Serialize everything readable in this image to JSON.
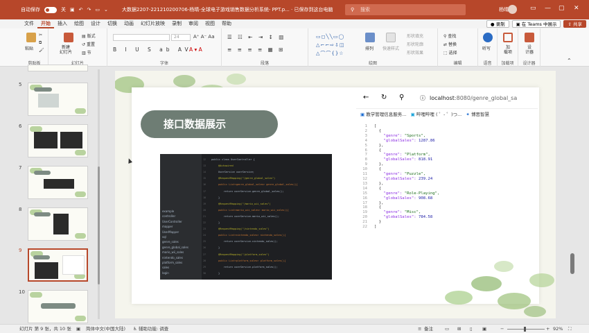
{
  "titlebar": {
    "autosave_label": "自动保存",
    "autosave_state": "关",
    "filename": "大数据2207-221210200706-杨晴-全球电子游戏销售数据分析系统- PPT.p...",
    "save_state": "已保存到这台电脑",
    "search_placeholder": "搜索",
    "user": "杨晴"
  },
  "menu": {
    "tabs": [
      "文件",
      "开始",
      "插入",
      "绘图",
      "设计",
      "切换",
      "动画",
      "幻灯片放映",
      "录制",
      "审阅",
      "视图",
      "帮助"
    ],
    "active": "开始",
    "record_btn": "录制",
    "teams_btn": "在 Teams 中展示",
    "share_btn": "共享"
  },
  "ribbon": {
    "clipboard": {
      "label": "剪贴板",
      "paste": "粘贴"
    },
    "slides": {
      "label": "幻灯片",
      "new_slide": "新建\n幻灯片",
      "layout": "版式",
      "reset": "重置",
      "section": "节"
    },
    "font": {
      "label": "字体",
      "size": "24"
    },
    "paragraph": {
      "label": "段落"
    },
    "drawing": {
      "label": "绘图",
      "arrange": "排列",
      "quick_styles": "快速样式",
      "fill": "形状填充",
      "outline": "形状轮廓",
      "effects": "形状效果"
    },
    "editing": {
      "label": "编辑",
      "find": "查找",
      "replace": "替换",
      "select": "选择"
    },
    "voice": {
      "label": "语音",
      "dictate": "听写"
    },
    "addins": {
      "label": "加载项",
      "addins": "加\n载项"
    },
    "designer": {
      "label": "设计器",
      "designer": "设\n计器"
    }
  },
  "slide_panel": {
    "numbers": [
      "5",
      "6",
      "7",
      "8",
      "9",
      "10"
    ],
    "selected": "9"
  },
  "slide": {
    "title": "接口数据展示",
    "browser": {
      "url_host": "localhost",
      "url_rest": ":8080/genre_global_sa",
      "bookmarks": [
        "教学管理信息服务...",
        "哔哩哔哩 ( ゜- ゜)つ...",
        "博思智慧"
      ]
    },
    "json_lines": [
      {
        "n": "1",
        "t": "["
      },
      {
        "n": "2",
        "t": "  {"
      },
      {
        "n": "3",
        "k": "    \"genre\": ",
        "s": "\"Sports\","
      },
      {
        "n": "4",
        "k": "    \"globalSales\": ",
        "v": "1287.86"
      },
      {
        "n": "5",
        "t": "  },"
      },
      {
        "n": "6",
        "t": "  {"
      },
      {
        "n": "7",
        "k": "    \"genre\": ",
        "s": "\"Platform\","
      },
      {
        "n": "8",
        "k": "    \"globalSales\": ",
        "v": "818.91"
      },
      {
        "n": "9",
        "t": "  },"
      },
      {
        "n": "10",
        "t": "  {"
      },
      {
        "n": "11",
        "k": "    \"genre\": ",
        "s": "\"Puzzle\","
      },
      {
        "n": "12",
        "k": "    \"globalSales\": ",
        "v": "239.24"
      },
      {
        "n": "13",
        "t": "  },"
      },
      {
        "n": "14",
        "t": "  {"
      },
      {
        "n": "15",
        "k": "    \"genre\": ",
        "s": "\"Role-Playing\","
      },
      {
        "n": "16",
        "k": "    \"globalSales\": ",
        "v": "908.68"
      },
      {
        "n": "17",
        "t": "  },"
      },
      {
        "n": "18",
        "t": "  {"
      },
      {
        "n": "19",
        "k": "    \"genre\": ",
        "s": "\"Misc\","
      },
      {
        "n": "20",
        "k": "    \"globalSales\": ",
        "v": "784.58"
      },
      {
        "n": "21",
        "t": "  }"
      },
      {
        "n": "22",
        "t": "]"
      }
    ],
    "ide_sidebar": [
      "example",
      "controller",
      "UserController",
      "mapper",
      "UserMapper",
      "sql",
      "genre_sales",
      "genre_global_sales",
      "mario_wii_sales",
      "nintendo_sales",
      "platform_sales",
      "sales",
      "login"
    ],
    "ide_code": [
      "public class UserController {",
      "@Autowired",
      "UserService userService;",
      "@RequestMapping(\"/genre_global_sales\")",
      "public List<genre_global_sales> genre_global_sales(){",
      "return userService.genre_global_sales();",
      "}",
      "@RequestMapping(\"/mario_wii_sales\")",
      "public List<mario_wii_sales> mario_wii_sales(){",
      "return userService.mario_wii_sales();",
      "}",
      "@RequestMapping(\"/nintendo_sales\")",
      "public List<nintendo_sales> nintendo_sales(){",
      "return userService.nintendo_sales();",
      "}",
      "@RequestMapping(\"/platform_sales\")",
      "public List<platform_sales> platform_sales(){",
      "return userService.platform_sales();",
      "}"
    ]
  },
  "statusbar": {
    "slide_of": "幻灯片 第 9 张，共 10 张",
    "language": "简体中文(中国大陆)",
    "accessibility": "辅助功能: 调查",
    "notes": "备注",
    "zoom": "92%"
  },
  "colors": {
    "accent": "#b7472a",
    "pill": "#6e7d74"
  }
}
